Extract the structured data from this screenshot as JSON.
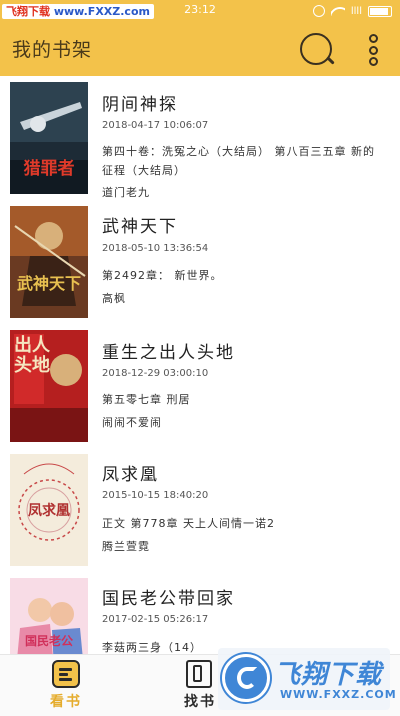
{
  "status_bar": {
    "watermark_left": "飞翔下载",
    "watermark_url": "www.FXXZ.com",
    "time": "23:12",
    "signal_label": "llll"
  },
  "header": {
    "title": "我的书架",
    "search_icon": "search-icon",
    "menu_icon": "more-vertical-icon",
    "background": "#f3c24a"
  },
  "books": [
    {
      "title": "阴间神探",
      "updated": "2018-04-17 10:06:07",
      "chapter": "第四十卷：洗冤之心（大结局） 第八百三五章 新的征程（大结局）",
      "author": "道门老九",
      "cover_text": "猎罪者",
      "cover_bg": "#1c2a36",
      "cover_text_color": "#e03a2a"
    },
    {
      "title": "武神天下",
      "updated": "2018-05-10 13:36:54",
      "chapter": "第2492章： 新世界。",
      "author": "高枫",
      "cover_text": "武神天下",
      "cover_bg": "#5a2e1c",
      "cover_text_color": "#e8c050"
    },
    {
      "title": "重生之出人头地",
      "updated": "2018-12-29 03:00:10",
      "chapter": "第五零七章 刑居",
      "author": "闹闹不爱闹",
      "cover_text": "出人头地",
      "cover_bg": "#b01e1e",
      "cover_text_color": "#f5e6c0"
    },
    {
      "title": "凤求凰",
      "updated": "2015-10-15 18:40:20",
      "chapter": "正文 第778章 天上人间情一诺2",
      "author": "腾兰萱霓",
      "cover_text": "凤求凰",
      "cover_bg": "#f4ecdc",
      "cover_text_color": "#b03030"
    },
    {
      "title": "国民老公带回家",
      "updated": "2017-02-15 05:26:17",
      "chapter": "李菇两三身（14）",
      "author": "",
      "cover_text": "国民老公",
      "cover_bg": "#f8dce6",
      "cover_text_color": "#d0305a"
    }
  ],
  "tabs": [
    {
      "label": "看书",
      "icon": "bookshelf-icon",
      "active": true
    },
    {
      "label": "找书",
      "icon": "find-book-icon",
      "active": false
    }
  ],
  "watermark": {
    "brand": "飞翔下载",
    "url": "WWW.FXXZ.COM"
  },
  "colors": {
    "accent": "#f3c24a",
    "active_tab": "#e5ac2c"
  }
}
